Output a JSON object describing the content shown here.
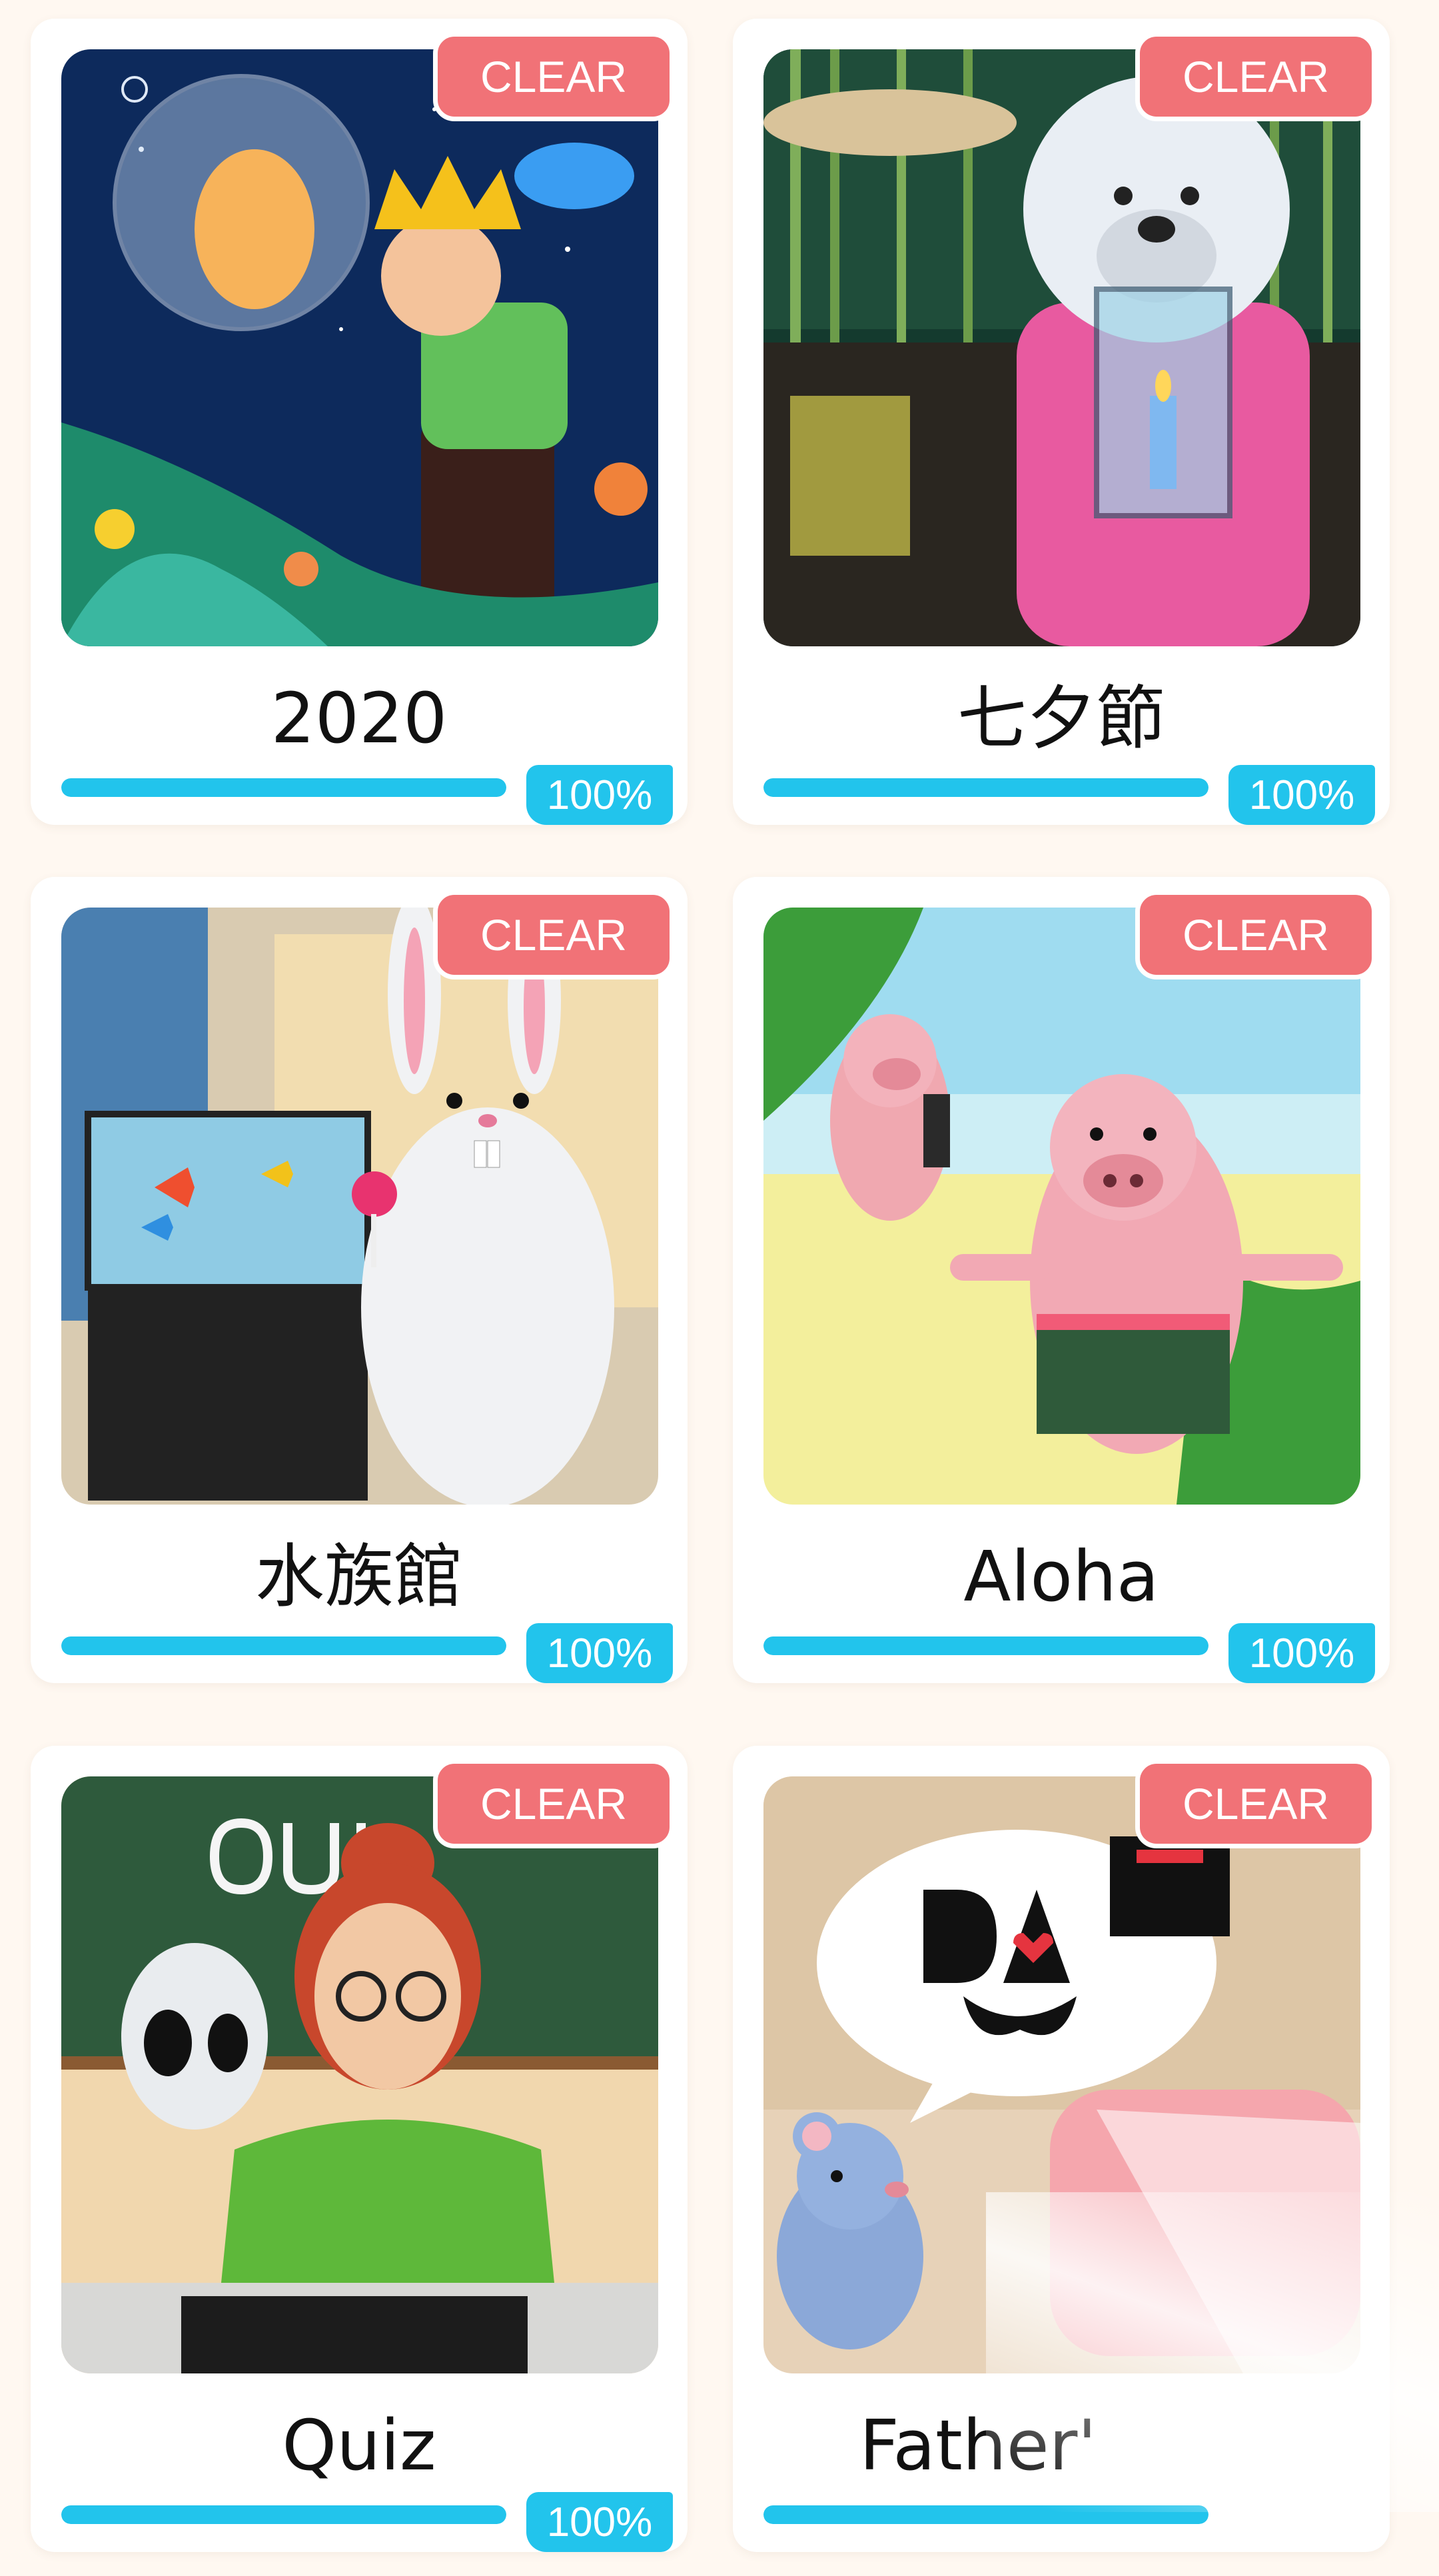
{
  "levels": [
    {
      "title": "2020",
      "badge": "CLEAR",
      "percent": "100%",
      "progress": 1.0,
      "art": "prince-moon-night"
    },
    {
      "title": "七夕節",
      "badge": "CLEAR",
      "percent": "100%",
      "progress": 1.0,
      "art": "bear-candle-lantern"
    },
    {
      "title": "水族館",
      "badge": "CLEAR",
      "percent": "100%",
      "progress": 1.0,
      "art": "rabbit-aquarium"
    },
    {
      "title": "Aloha",
      "badge": "CLEAR",
      "percent": "100%",
      "progress": 1.0,
      "art": "pigs-beach"
    },
    {
      "title": "Quiz",
      "badge": "CLEAR",
      "percent": "100%",
      "progress": 1.0,
      "art": "teacher-alien-chalkboard"
    },
    {
      "title": "Father'",
      "badge": "CLEAR",
      "percent": "",
      "progress": 1.0,
      "art": "mouse-dad-bubble"
    }
  ],
  "colors": {
    "background": "#fff8f1",
    "card": "#ffffff",
    "clear_badge": "#f17277",
    "progress": "#22c4ec"
  }
}
